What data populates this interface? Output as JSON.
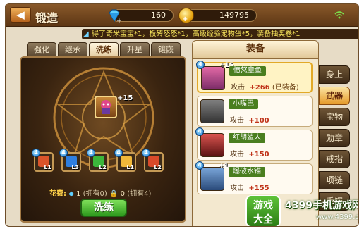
{
  "header": {
    "back_icon": "back-arrow-icon",
    "title": "锻造",
    "gems": "160",
    "gold": "149795"
  },
  "ticker": {
    "text": "得了奇米宝宝*1，板砖怒怒*1，高级经验宠物蛋*5，装备抽奖卷*1"
  },
  "tabs": [
    {
      "label": "强化"
    },
    {
      "label": "继承"
    },
    {
      "label": "洗练",
      "active": true
    },
    {
      "label": "升星"
    },
    {
      "label": "镶嵌"
    }
  ],
  "forge": {
    "center_item_plus": "+15",
    "materials": [
      {
        "count": "4",
        "level": "L1",
        "color": "#d9542a"
      },
      {
        "count": "4",
        "level": "L3",
        "color": "#2f7fe0"
      },
      {
        "count": "4",
        "level": "L2",
        "color": "#3bb63b"
      },
      {
        "count": "4",
        "level": "L1",
        "color": "#f0b83a"
      },
      {
        "count": "4",
        "level": "L2",
        "color": "#d84a2a"
      }
    ],
    "cost_label": "花费:",
    "cost_part1": "1",
    "cost_part1_sub": "(拥有0)",
    "cost_part2": "0",
    "cost_part2_sub": "(拥有4)",
    "action_label": "洗练"
  },
  "equipment": {
    "header": "装备",
    "items": [
      {
        "name": "愤怒章鱼",
        "stat_label": "攻击",
        "stat_value": "+266",
        "note": "(已装备)",
        "plus": "+15",
        "badge": "4"
      },
      {
        "name": "小嘴巴",
        "stat_label": "攻击",
        "stat_value": "+100",
        "note": "",
        "plus": "",
        "badge": ""
      },
      {
        "name": "红胡鲨人",
        "stat_label": "攻击",
        "stat_value": "+150",
        "note": "",
        "plus": "",
        "badge": "4"
      },
      {
        "name": "爆破水锚",
        "stat_label": "攻击",
        "stat_value": "+155",
        "note": "",
        "plus": "+1",
        "badge": "4"
      }
    ]
  },
  "slots": [
    {
      "label": "身上"
    },
    {
      "label": "武器",
      "active": true
    },
    {
      "label": "宝物"
    },
    {
      "label": "勋章"
    },
    {
      "label": "戒指"
    },
    {
      "label": "项链"
    },
    {
      "label": "手镯"
    }
  ],
  "watermark": {
    "logo_line1": "游戏",
    "logo_line2": "大全",
    "text": "4399手机游戏网",
    "url": "www.4399.cn"
  }
}
